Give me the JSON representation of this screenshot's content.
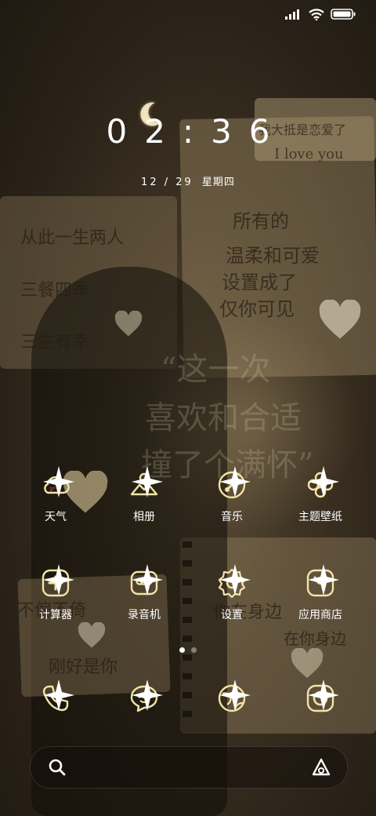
{
  "status_bar": {
    "signal_icon": "signal-bars-icon",
    "wifi_icon": "wifi-icon",
    "battery_icon": "battery-full-icon"
  },
  "clock": {
    "time": "02:36",
    "date": "12 / 29",
    "weekday": "星期四"
  },
  "wallpaper": {
    "texts": [
      "从此一生两人",
      "三餐四季",
      "三生有幸",
      "我大抵是恋爱了",
      "I love you",
      "所有的",
      "温柔和可爱",
      "设置成了",
      "仅你可见",
      "“这一次",
      "喜欢和合适",
      "撞了个满怀”",
      "不偏不倚",
      "刚好是你",
      "你在身边",
      "在你身边"
    ]
  },
  "apps": [
    {
      "label": "天气",
      "icon": "weather-cloud-icon"
    },
    {
      "label": "相册",
      "icon": "gallery-icon"
    },
    {
      "label": "音乐",
      "icon": "music-icon"
    },
    {
      "label": "主题壁纸",
      "icon": "themes-flower-icon"
    },
    {
      "label": "计算器",
      "icon": "calculator-icon"
    },
    {
      "label": "录音机",
      "icon": "recorder-icon"
    },
    {
      "label": "设置",
      "icon": "settings-gear-icon"
    },
    {
      "label": "应用商店",
      "icon": "app-store-icon"
    }
  ],
  "dock": [
    {
      "icon": "phone-icon"
    },
    {
      "icon": "messages-icon"
    },
    {
      "icon": "browser-icon"
    },
    {
      "icon": "camera-icon"
    }
  ],
  "page_indicator": {
    "pages": 2,
    "active": 1
  },
  "search": {
    "search_icon": "search-icon",
    "assistant_icon": "assistant-icon"
  },
  "colors": {
    "accent": "#f3e4a6",
    "glow": "#ffe9a0"
  }
}
